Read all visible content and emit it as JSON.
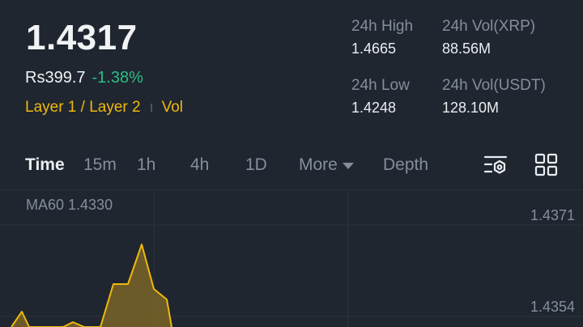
{
  "ticker": {
    "last_price": "1.4317",
    "fiat_price": "Rs399.7",
    "change_pct": "-1.38%",
    "tag_layer": "Layer 1 / Layer 2",
    "tag_vol": "Vol"
  },
  "stats": {
    "high_label": "24h High",
    "high_value": "1.4665",
    "low_label": "24h Low",
    "low_value": "1.4248",
    "vol_base_label": "24h Vol(XRP)",
    "vol_base_value": "88.56M",
    "vol_quote_label": "24h Vol(USDT)",
    "vol_quote_value": "128.10M"
  },
  "tabs": {
    "time": "Time",
    "m15": "15m",
    "h1": "1h",
    "h4": "4h",
    "d1": "1D",
    "more": "More",
    "depth": "Depth"
  },
  "icons": {
    "indicator": "chart-settings-icon",
    "layout": "grid-layout-icon"
  },
  "chart": {
    "ma_label": "MA60 1.4330",
    "price_ticks": [
      "1.4371",
      "1.4354"
    ]
  },
  "colors": {
    "background": "#1f2630",
    "positive": "#2ebd85",
    "accent": "#f0b90b",
    "muted": "#848e9c"
  }
}
